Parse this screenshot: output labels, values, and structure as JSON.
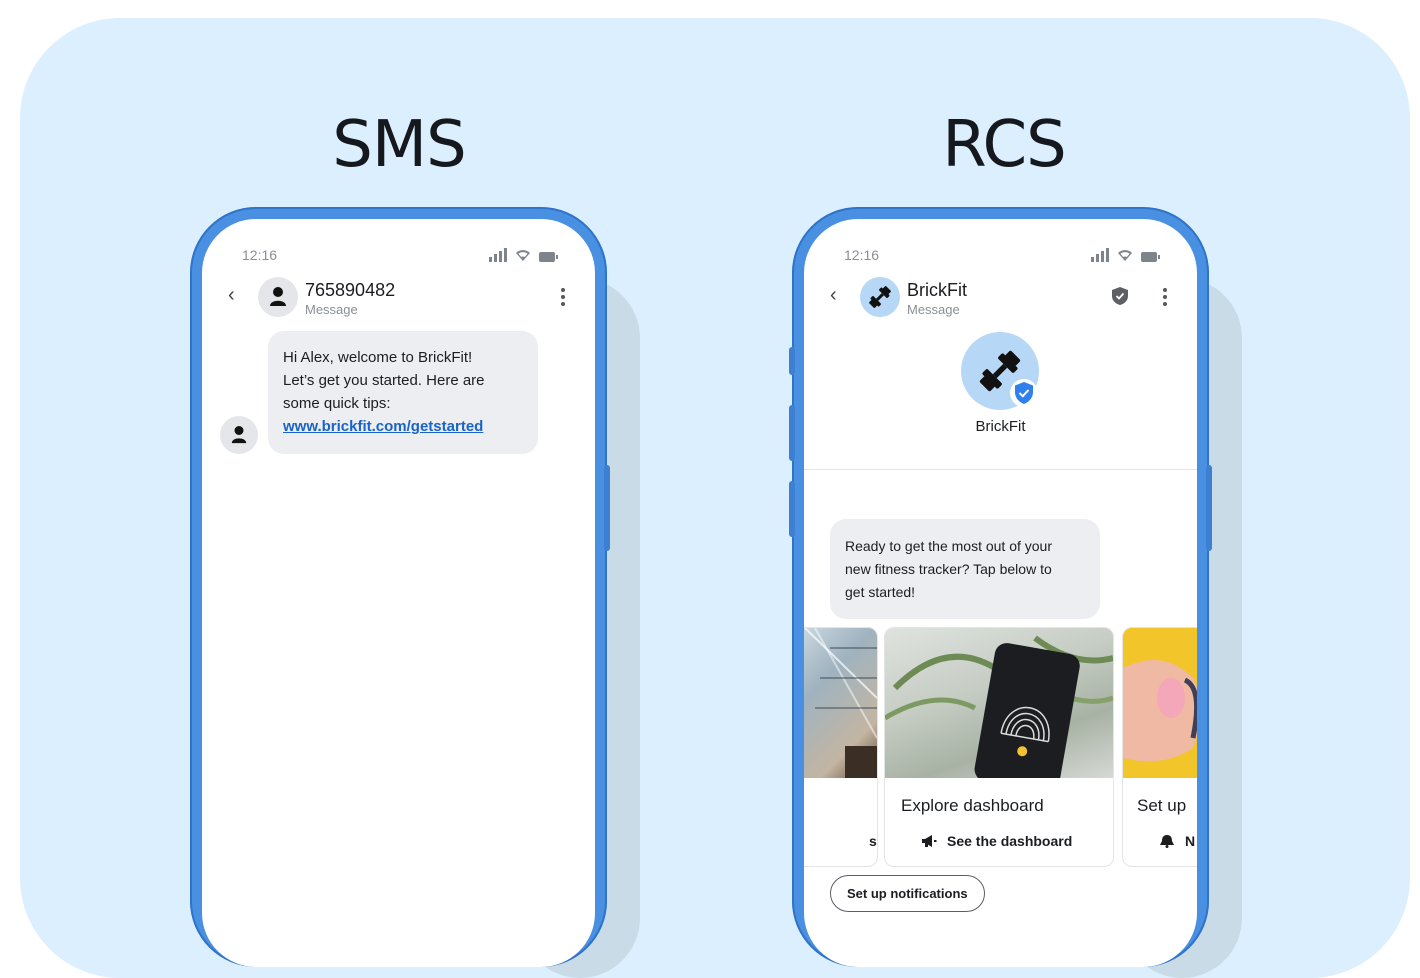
{
  "headings": {
    "sms": "SMS",
    "rcs": "RCS"
  },
  "sms_phone": {
    "status_time": "12:16",
    "contact_number": "765890482",
    "contact_subtitle": "Message",
    "message": {
      "line1": "Hi Alex, welcome to BrickFit!",
      "line2": "Let’s get you started. Here are",
      "line3": "some quick tips:",
      "link": "www.brickfit.com/getstarted"
    }
  },
  "rcs_phone": {
    "status_time": "12:16",
    "brand_name": "BrickFit",
    "brand_subtitle": "Message",
    "profile_name": "BrickFit",
    "message": {
      "line1": "Ready to get the most out of your",
      "line2": "new fitness tracker? Tap below to",
      "line3": "get started!"
    },
    "cards": [
      {
        "title": "",
        "action": "s"
      },
      {
        "title": "Explore dashboard",
        "action": "See the dashboard"
      },
      {
        "title": "Set up",
        "action": "N"
      }
    ],
    "suggestion_chip": "Set up notifications"
  },
  "colors": {
    "panel": "#dcefff",
    "phone_frame": "#4a90e2",
    "bubble": "#eceef1",
    "link": "#1a63c9",
    "verified_badge": "#2f80ed"
  }
}
